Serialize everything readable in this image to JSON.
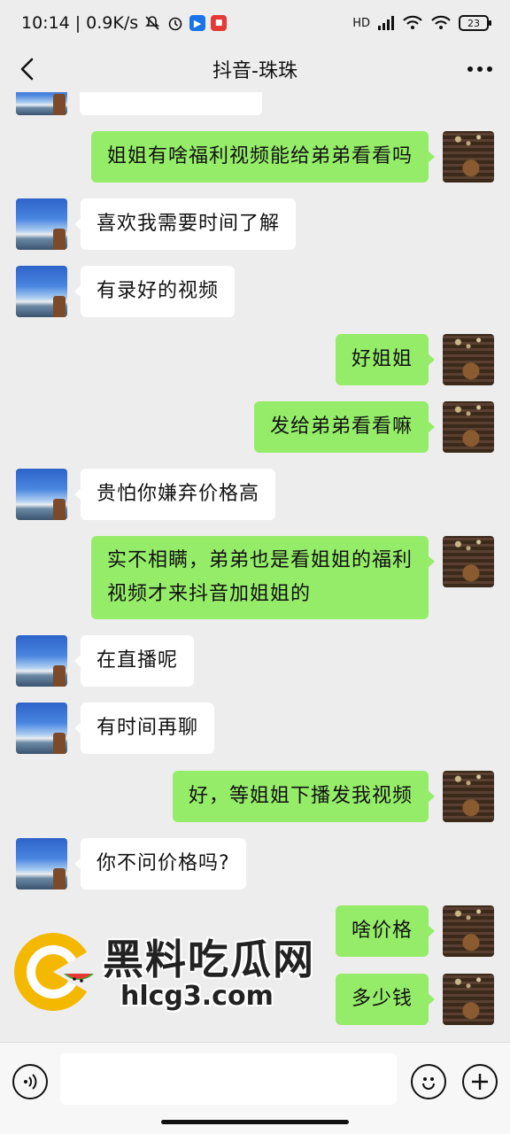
{
  "status_bar": {
    "time": "10:14",
    "speed": "0.9K/s",
    "battery": "23",
    "hd_label": "HD"
  },
  "header": {
    "title": "抖音-珠珠"
  },
  "messages": [
    {
      "side": "self",
      "text": "姐姐有啥福利视频能给弟弟看看吗"
    },
    {
      "side": "other",
      "text": "喜欢我需要时间了解"
    },
    {
      "side": "other",
      "text": "有录好的视频"
    },
    {
      "side": "self",
      "text": "好姐姐"
    },
    {
      "side": "self",
      "text": "发给弟弟看看嘛"
    },
    {
      "side": "other",
      "text": "贵怕你嫌弃价格高"
    },
    {
      "side": "self",
      "text_line1": "实不相瞒，弟弟也是看姐姐的福利",
      "text_line2": "视频才来抖音加姐姐的"
    },
    {
      "side": "other",
      "text": "在直播呢"
    },
    {
      "side": "other",
      "text": "有时间再聊"
    },
    {
      "side": "self",
      "text": "好，等姐姐下播发我视频"
    },
    {
      "side": "other",
      "text": "你不问价格吗?"
    },
    {
      "side": "self",
      "text": "啥价格"
    },
    {
      "side": "self",
      "text": "多少钱"
    }
  ],
  "watermark": {
    "line1": "黑料吃瓜网",
    "line2": "hlcg3.com"
  },
  "icons": {
    "back": "chevron-left-icon",
    "more": "more-dots-icon",
    "voice": "voice-icon",
    "emoji": "emoji-icon",
    "plus": "plus-icon"
  },
  "colors": {
    "self_bubble": "#95ec69",
    "other_bubble": "#ffffff",
    "background": "#ededed"
  }
}
